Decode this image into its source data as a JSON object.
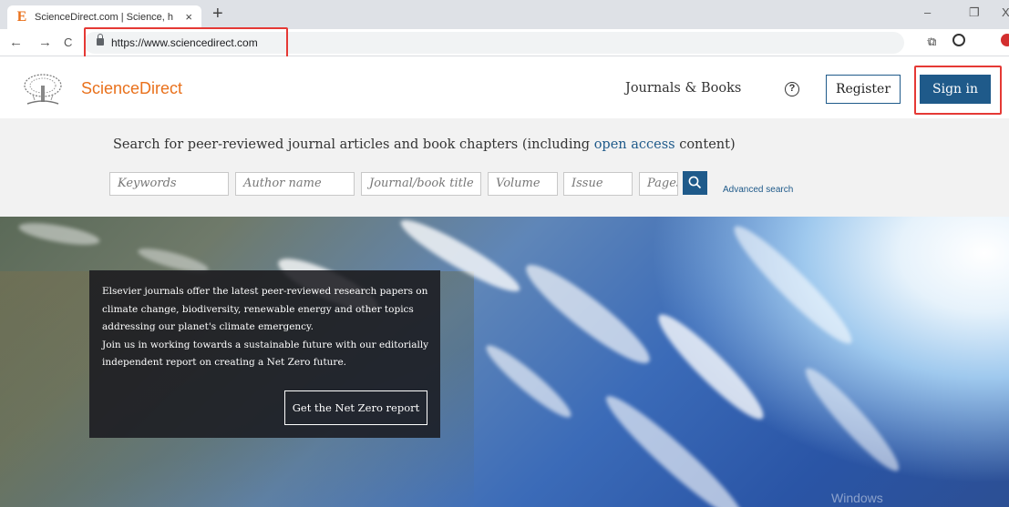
{
  "browser": {
    "tab_title": "ScienceDirect.com | Science, h",
    "favicon": "E",
    "close_glyph": "×",
    "new_tab_glyph": "+",
    "url": "https://www.sciencedirect.com",
    "window_minimize": "–",
    "window_restore": "❐",
    "window_close": "X",
    "back_glyph": "←",
    "forward_glyph": "→",
    "reload_glyph": "C",
    "translate_glyph": "⧉",
    "star_glyph": "☆",
    "highlight_color": "#e53935"
  },
  "header": {
    "brand": "ScienceDirect",
    "nav_journals": "Journals & Books",
    "help_glyph": "?",
    "register": "Register",
    "sign_in": "Sign in",
    "accent": "#e9711c",
    "primary": "#1f5a8a"
  },
  "search": {
    "title_before": "Search for peer-reviewed journal articles and book chapters (including ",
    "title_link": "open access",
    "title_after": " content)",
    "fields": {
      "keywords": "Keywords",
      "author": "Author name",
      "journal": "Journal/book title",
      "volume": "Volume",
      "issue": "Issue",
      "pages": "Pages"
    },
    "advanced": "Advanced search"
  },
  "promo": {
    "paragraph1": "Elsevier journals offer the latest peer-reviewed research papers on climate change, biodiversity, renewable energy and other topics addressing our planet's climate emergency.",
    "paragraph2": "Join us in working towards a sustainable future with our editorially independent report on creating a Net Zero future.",
    "button": "Get the Net Zero report"
  },
  "watermark": "Windows"
}
